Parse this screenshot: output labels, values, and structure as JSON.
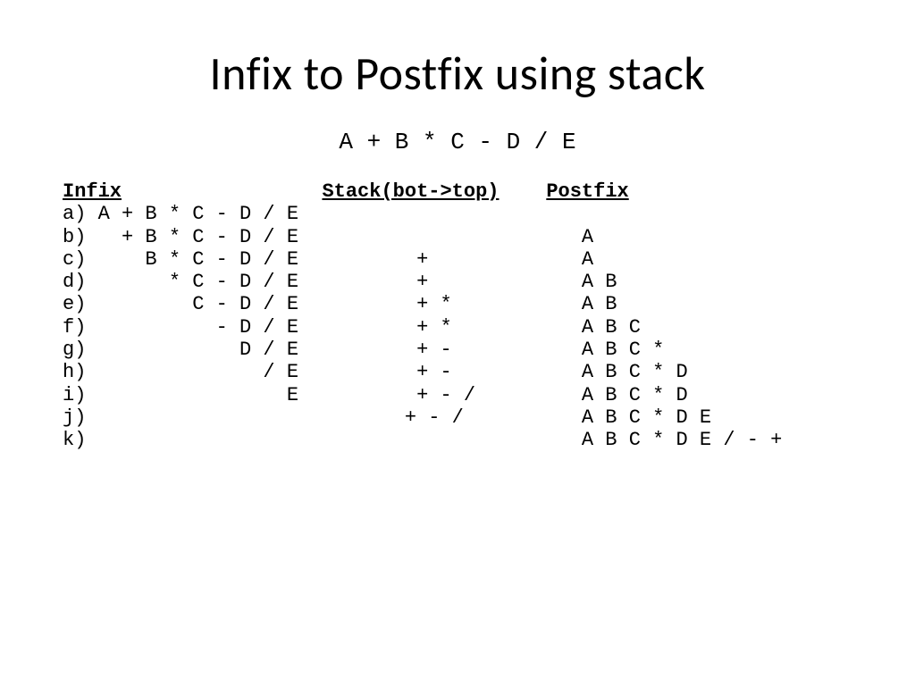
{
  "title": "Infix to Postfix  using  stack",
  "expression": "A + B * C - D / E",
  "headers": {
    "infix": "Infix",
    "stack": "Stack(bot->top)",
    "postfix": "Postfix"
  },
  "rows": [
    {
      "label": "a)",
      "infix": "A + B * C - D / E",
      "stack": "",
      "postfix": ""
    },
    {
      "label": "b)",
      "infix": "  + B * C - D / E",
      "stack": "",
      "postfix": "A"
    },
    {
      "label": "c)",
      "infix": "    B * C - D / E",
      "stack": "+",
      "postfix": "A"
    },
    {
      "label": "d)",
      "infix": "      * C - D / E",
      "stack": "+",
      "postfix": "A B"
    },
    {
      "label": "e)",
      "infix": "        C - D / E",
      "stack": "+ *",
      "postfix": "A B"
    },
    {
      "label": "f)",
      "infix": "          - D / E",
      "stack": "+ *",
      "postfix": "A B C"
    },
    {
      "label": "g)",
      "infix": "            D / E",
      "stack": "+ -",
      "postfix": "A B C *"
    },
    {
      "label": "h)",
      "infix": "              / E",
      "stack": "+ -",
      "postfix": "A B C * D"
    },
    {
      "label": "i)",
      "infix": "                E",
      "stack": "+ - /",
      "postfix": "A B C * D"
    },
    {
      "label": "j)",
      "infix": "                 ",
      "stack": "+ - /",
      "postfix": "A B C * D E"
    },
    {
      "label": "k)",
      "infix": "                 ",
      "stack": "",
      "postfix": "A B C * D E / - +"
    }
  ],
  "chart_data": {
    "type": "table",
    "title": "Infix to Postfix using stack",
    "columns": [
      "step",
      "Infix",
      "Stack(bot->top)",
      "Postfix"
    ],
    "rows": [
      [
        "a",
        "A + B * C - D / E",
        "",
        ""
      ],
      [
        "b",
        "+ B * C - D / E",
        "",
        "A"
      ],
      [
        "c",
        "B * C - D / E",
        "+",
        "A"
      ],
      [
        "d",
        "* C - D / E",
        "+",
        "A B"
      ],
      [
        "e",
        "C - D / E",
        "+ *",
        "A B"
      ],
      [
        "f",
        "- D / E",
        "+ *",
        "A B C"
      ],
      [
        "g",
        "D / E",
        "+ -",
        "A B C *"
      ],
      [
        "h",
        "/ E",
        "+ -",
        "A B C * D"
      ],
      [
        "i",
        "E",
        "+ - /",
        "A B C * D"
      ],
      [
        "j",
        "",
        "+ - /",
        "A B C * D E"
      ],
      [
        "k",
        "",
        "",
        "A B C * D E / - +"
      ]
    ]
  }
}
